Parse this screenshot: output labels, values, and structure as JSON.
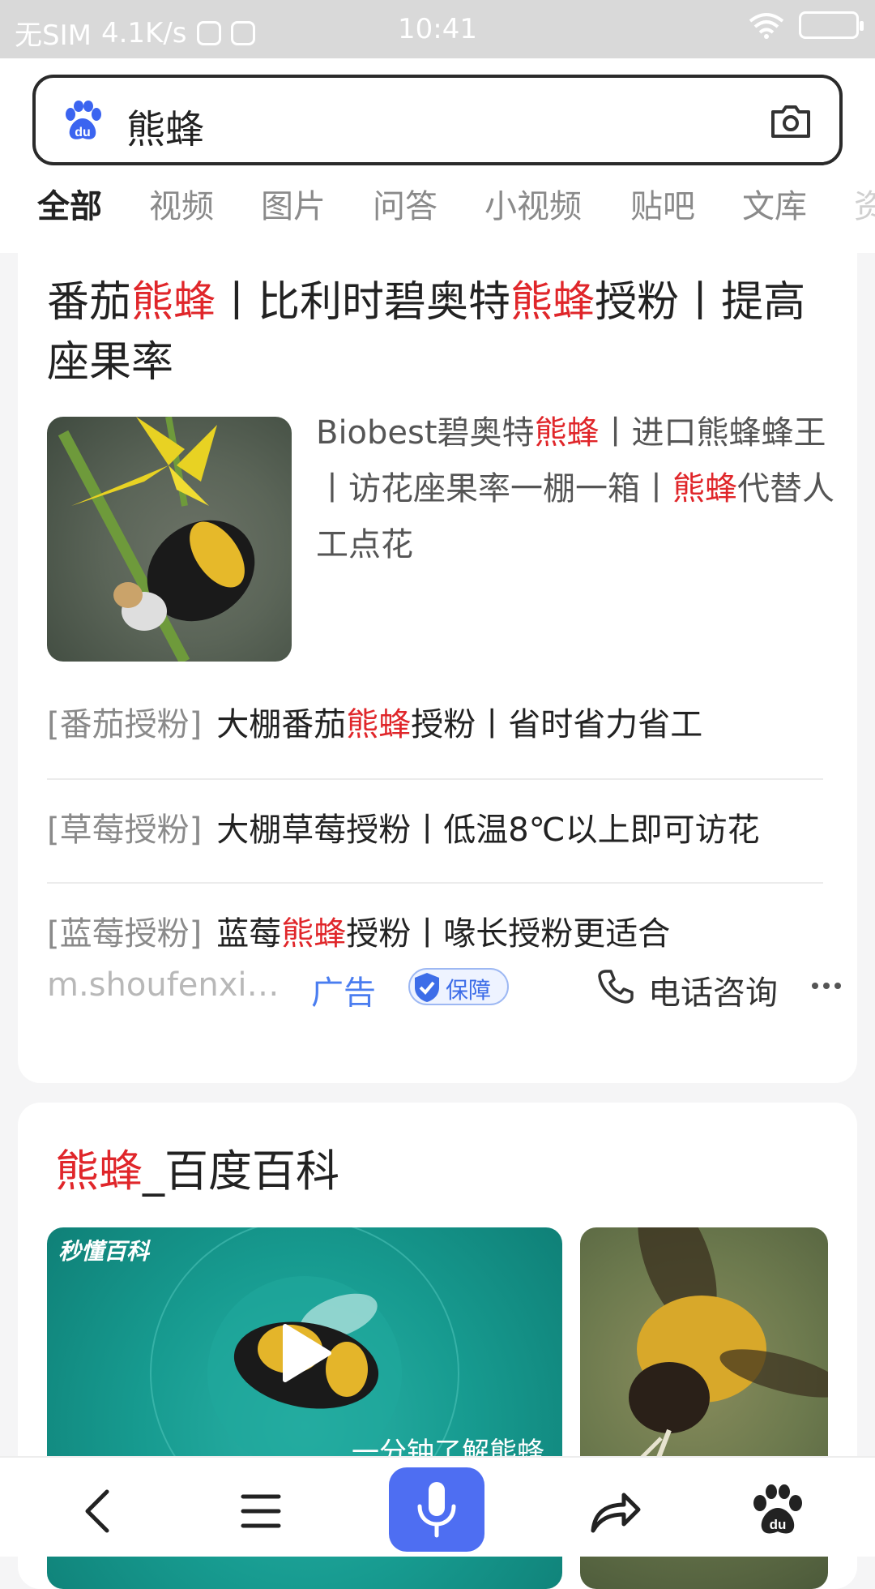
{
  "status_bar": {
    "carrier": "无SIM",
    "speed": "4.1K/s",
    "time": "10:41"
  },
  "search": {
    "query": "熊蜂"
  },
  "tabs": [
    {
      "label": "全部",
      "active": true
    },
    {
      "label": "视频"
    },
    {
      "label": "图片"
    },
    {
      "label": "问答"
    },
    {
      "label": "小视频"
    },
    {
      "label": "贴吧"
    },
    {
      "label": "文库"
    },
    {
      "label": "资"
    }
  ],
  "ad_card": {
    "title": [
      "番茄",
      "熊蜂",
      "丨比利时碧奥特",
      "熊蜂",
      "授粉丨提高座果率"
    ],
    "desc": [
      "Biobest碧奥特",
      "熊蜂",
      "丨进口熊蜂蜂王丨访花座果率一棚一箱丨",
      "熊蜂",
      "代替人工点花"
    ],
    "sub_links": [
      {
        "tag": "[番茄授粉]",
        "text": [
          "大棚番茄",
          "熊蜂",
          "授粉丨省时省力省工"
        ]
      },
      {
        "tag": "[草莓授粉]",
        "text": [
          "大棚草莓授粉丨低温8℃以上即可访花"
        ]
      },
      {
        "tag": "[蓝莓授粉]",
        "text": [
          "蓝莓",
          "熊蜂",
          "授粉丨喙长授粉更适合"
        ]
      }
    ],
    "source": "m.shoufenxi…",
    "ad_label": "广告",
    "guarantee": "保障",
    "phone_label": "电话咨询"
  },
  "baike_card": {
    "title_highlight": "熊蜂",
    "title_rest": "_百度百科",
    "video_brand": "秒懂百科",
    "video_caption": "一分钟了解熊蜂"
  },
  "colors": {
    "highlight": "#e0262a",
    "accent": "#4e6ef2"
  }
}
